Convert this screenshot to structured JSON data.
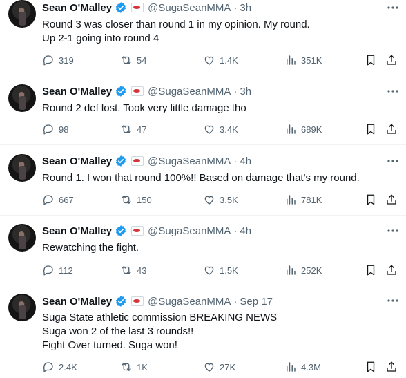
{
  "colors": {
    "verified": "#1d9bf0",
    "secondary_text": "#536471",
    "primary_text": "#0f1419"
  },
  "icons": [
    "verified-badge-icon",
    "affiliate-badge-icon",
    "more-icon",
    "reply-icon",
    "retweet-icon",
    "like-icon",
    "views-icon",
    "bookmark-icon",
    "share-icon"
  ],
  "tweets": [
    {
      "name": "Sean O'Malley",
      "handle": "@SugaSeanMMA",
      "sep": "·",
      "time": "3h",
      "lines": [
        "Round 3 was closer than round 1 in my opinion. My round.",
        "Up 2-1 going into round 4"
      ],
      "replies": "319",
      "retweets": "54",
      "likes": "1.4K",
      "views": "351K"
    },
    {
      "name": "Sean O'Malley",
      "handle": "@SugaSeanMMA",
      "sep": "·",
      "time": "3h",
      "lines": [
        "Round 2 def lost. Took very little damage tho"
      ],
      "replies": "98",
      "retweets": "47",
      "likes": "3.4K",
      "views": "689K"
    },
    {
      "name": "Sean O'Malley",
      "handle": "@SugaSeanMMA",
      "sep": "·",
      "time": "4h",
      "lines": [
        "Round 1. I won that round 100%!!  Based on damage that's my round."
      ],
      "replies": "667",
      "retweets": "150",
      "likes": "3.5K",
      "views": "781K"
    },
    {
      "name": "Sean O'Malley",
      "handle": "@SugaSeanMMA",
      "sep": "·",
      "time": "4h",
      "lines": [
        "Rewatching the fight."
      ],
      "replies": "112",
      "retweets": "43",
      "likes": "1.5K",
      "views": "252K"
    },
    {
      "name": "Sean O'Malley",
      "handle": "@SugaSeanMMA",
      "sep": "·",
      "time": "Sep 17",
      "lines": [
        "Suga State athletic commission BREAKING NEWS",
        "Suga won 2 of the last 3 rounds!!",
        "Fight Over turned. Suga won!"
      ],
      "replies": "2.4K",
      "retweets": "1K",
      "likes": "27K",
      "views": "4.3M"
    }
  ]
}
